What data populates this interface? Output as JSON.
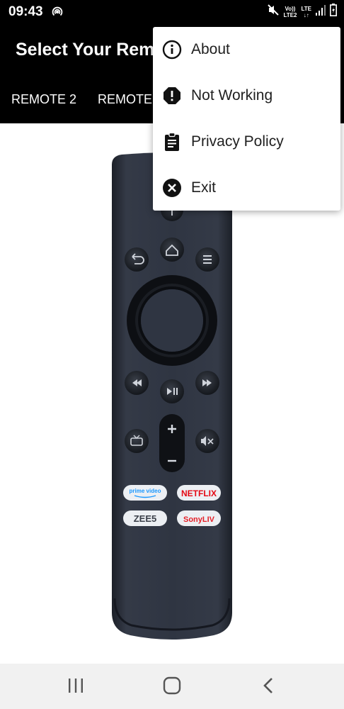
{
  "status_bar": {
    "time": "09:43",
    "network_top": "Vo))",
    "network_bottom": "LTE2",
    "lte_label": "LTE"
  },
  "app_bar": {
    "title": "Select Your Rem",
    "tabs": [
      {
        "label": "REMOTE 2"
      },
      {
        "label": "REMOTE"
      }
    ]
  },
  "remote": {
    "streaming_buttons": {
      "prime": "prime video",
      "netflix": "NETFLIX",
      "zee5": "ZEE5",
      "sonyliv": "SonyLIV"
    },
    "colors": {
      "body": "#2e3440",
      "prime": "#1a98ff",
      "netflix": "#e50914",
      "sonyliv": "#e41e26"
    }
  },
  "overflow_menu": {
    "items": [
      {
        "label": "About",
        "icon": "info-icon"
      },
      {
        "label": "Not Working",
        "icon": "alert-icon"
      },
      {
        "label": "Privacy Policy",
        "icon": "clipboard-icon"
      },
      {
        "label": "Exit",
        "icon": "close-circle-icon"
      }
    ]
  },
  "nav_bar": {
    "buttons": [
      "recents-icon",
      "home-icon",
      "back-icon"
    ]
  }
}
